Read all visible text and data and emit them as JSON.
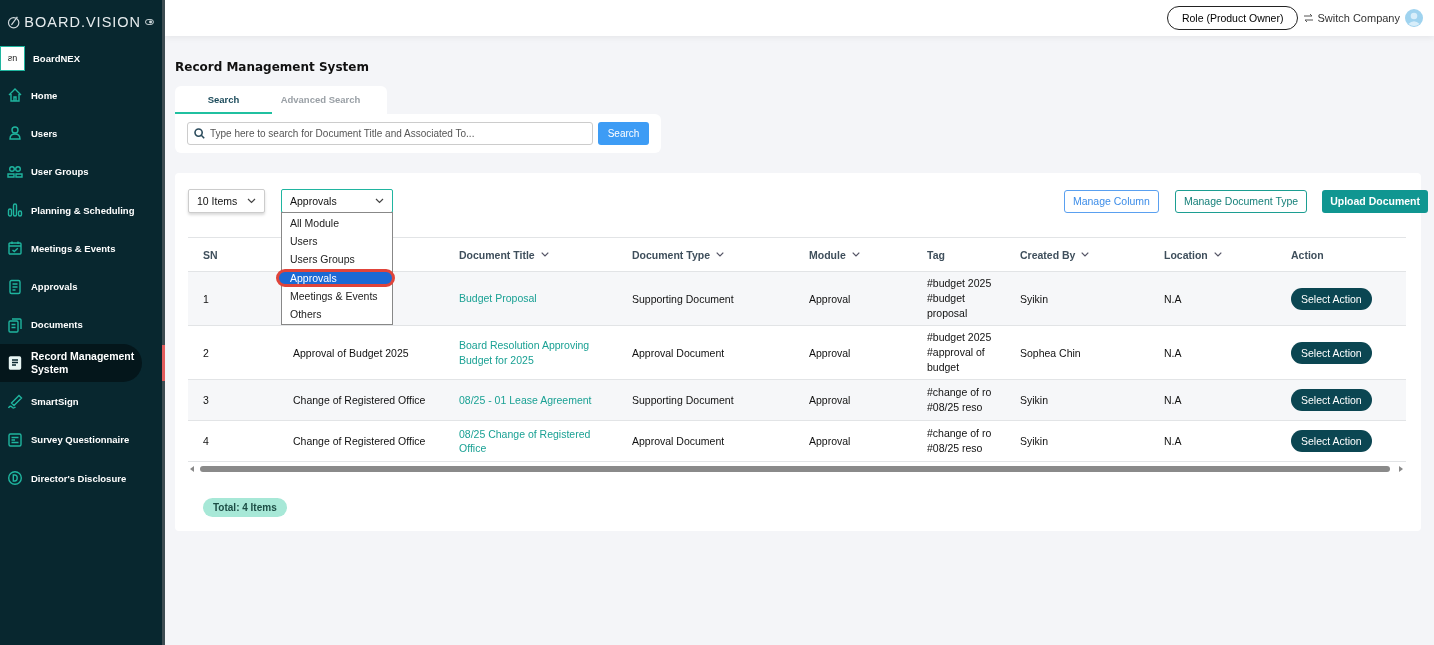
{
  "brand": {
    "name": "BOARD.VISION"
  },
  "sidebar": {
    "company": {
      "logo": "ƨn",
      "name": "BoardNEX"
    },
    "items": [
      {
        "label": "Home",
        "selected": false
      },
      {
        "label": "Users",
        "selected": false
      },
      {
        "label": "User Groups",
        "selected": false
      },
      {
        "label": "Planning & Scheduling",
        "selected": false
      },
      {
        "label": "Meetings & Events",
        "selected": false
      },
      {
        "label": "Approvals",
        "selected": false
      },
      {
        "label": "Documents",
        "selected": false
      },
      {
        "label": "Record Management System",
        "selected": true
      },
      {
        "label": "SmartSign",
        "selected": false
      },
      {
        "label": "Survey Questionnaire",
        "selected": false
      },
      {
        "label": "Director's Disclosure",
        "selected": false
      }
    ]
  },
  "topbar": {
    "role": "Role (Product Owner)",
    "switch": "Switch Company"
  },
  "page_title": "Record Management System",
  "tabs": [
    {
      "label": "Search",
      "selected": true
    },
    {
      "label": "Advanced Search",
      "selected": false
    }
  ],
  "search": {
    "placeholder": "Type here to search for Document Title and Associated To...",
    "button": "Search"
  },
  "page_size": "10 Items",
  "module_filter": {
    "value": "Approvals",
    "expanded": true,
    "options": [
      {
        "label": "All Module",
        "selected": false
      },
      {
        "label": "Users",
        "selected": false
      },
      {
        "label": "Users Groups",
        "selected": false
      },
      {
        "label": "Approvals",
        "selected": true
      },
      {
        "label": "Meetings & Events",
        "selected": false
      },
      {
        "label": "Others",
        "selected": false
      }
    ]
  },
  "actions": [
    "Manage Column",
    "Manage Document Type",
    "Upload Document"
  ],
  "table": {
    "columns": [
      {
        "label": "SN",
        "sortable": false
      },
      {},
      {
        "label": "Document Title",
        "sortable": true
      },
      {
        "label": "Document Type",
        "sortable": true
      },
      {
        "label": "Module",
        "sortable": true
      },
      {
        "label": "Tag",
        "sortable": false
      },
      {
        "label": "Created By",
        "sortable": true
      },
      {
        "label": "Location",
        "sortable": true
      },
      {
        "label": "Action",
        "sortable": false
      }
    ],
    "rows": [
      {
        "sn": "1",
        "title": "Budget Proposal",
        "type": "Supporting Document",
        "module": "Approval",
        "tags": [
          "#budget 2025",
          "#budget proposal"
        ],
        "created_by": "Syikin",
        "location": "N.A",
        "action": "Select Action"
      },
      {
        "sn": "2",
        "name": "Approval of Budget 2025",
        "title": "Board Resolution Approving Budget for 2025",
        "type": "Approval Document",
        "module": "Approval",
        "tags": [
          "#budget 2025",
          "#approval of budget"
        ],
        "created_by": "Sophea Chin",
        "location": "N.A",
        "action": "Select Action"
      },
      {
        "sn": "3",
        "name": "Change of Registered Office",
        "title": "08/25 - 01 Lease Agreement",
        "type": "Supporting Document",
        "module": "Approval",
        "tags": [
          "#change of ro",
          "#08/25 reso"
        ],
        "created_by": "Syikin",
        "location": "N.A",
        "action": "Select Action"
      },
      {
        "sn": "4",
        "name": "Change of Registered Office",
        "title": "08/25 Change of Registered Office",
        "type": "Approval Document",
        "module": "Approval",
        "tags": [
          "#change of ro",
          "#08/25 reso"
        ],
        "created_by": "Syikin",
        "location": "N.A",
        "action": "Select Action"
      }
    ]
  },
  "total": "Total: 4 Items"
}
